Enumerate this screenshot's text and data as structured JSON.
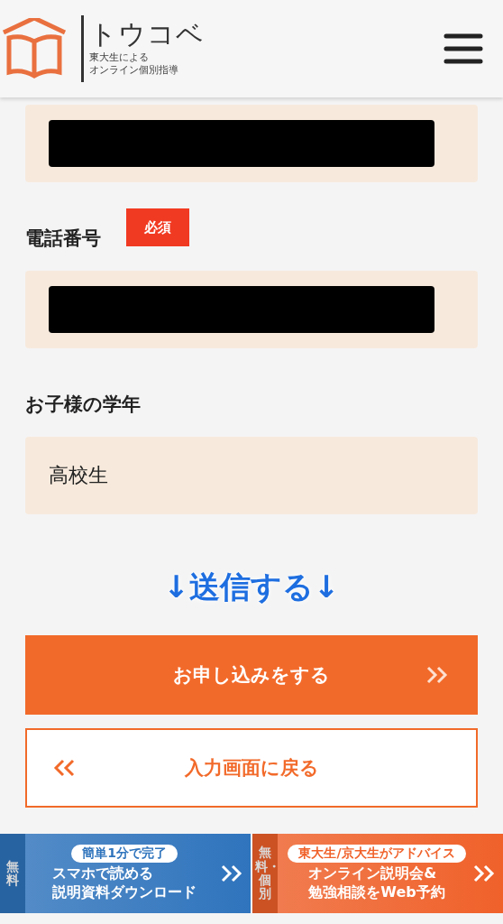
{
  "header": {
    "title": "トウコベ",
    "subtitle_lines": [
      "東大生による",
      "オンライン個別指導"
    ]
  },
  "fields": [
    {
      "redacted": true
    },
    {
      "label": "電話番号",
      "required_badge": "必須",
      "redacted": true
    },
    {
      "label": "お子様の学年",
      "value": "高校生"
    }
  ],
  "submit_hint": "↓送信する↓",
  "submit_button": {
    "label": "お申し込みをする"
  },
  "back_button": {
    "label": "入力画面に戻る"
  },
  "banners": [
    {
      "tag": "無料",
      "badge": "簡単1分で完了",
      "lines": [
        "スマホで読める",
        "説明資料ダウンロード"
      ],
      "color": "#2f74bd"
    },
    {
      "tag": "無料・個別",
      "badge": "東大生/京大生がアドバイス",
      "lines": [
        "オンライン説明会&",
        "勉強相談をWeb予約"
      ],
      "color": "#f0612a"
    }
  ]
}
